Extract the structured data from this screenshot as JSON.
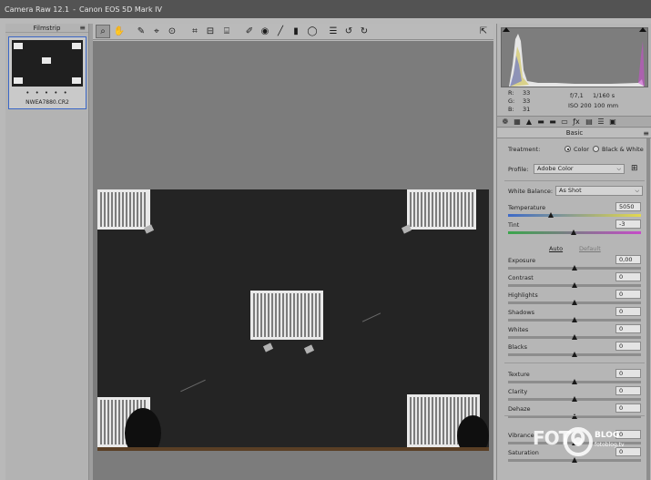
{
  "app": {
    "title": "Camera Raw 12.1",
    "separator": "-",
    "camera": "Canon EOS 5D Mark IV"
  },
  "filmstrip": {
    "header": "Filmstrip",
    "menu_icon": "panel-menu-icon",
    "thumbnail": {
      "dots": "• • • • •",
      "filename": "NWEA7880.CR2"
    }
  },
  "toolbar": {
    "icons": [
      "zoom-icon",
      "hand-icon",
      "white-balance-icon",
      "color-sampler-icon",
      "target-adjustment-icon",
      "crop-icon",
      "straighten-icon",
      "transform-icon",
      "spot-removal-icon",
      "red-eye-icon",
      "adjustment-brush-icon",
      "graduated-filter-icon",
      "radial-filter-icon",
      "preferences-icon",
      "rotate-left-icon",
      "rotate-right-icon"
    ],
    "fullscreen_icon": "toggle-fullscreen-icon"
  },
  "readout": {
    "r_label": "R:",
    "r_value": "33",
    "g_label": "G:",
    "g_value": "33",
    "b_label": "B:",
    "b_value": "31",
    "aperture": "f/7,1",
    "shutter": "1/160 s",
    "iso": "ISO 200",
    "focal": "100 mm"
  },
  "panel_tabs": [
    "basic-icon",
    "tone-curve-icon",
    "detail-icon",
    "hsl-icon",
    "split-toning-icon",
    "lens-icon",
    "effects-icon",
    "calibration-icon",
    "presets-icon",
    "snapshots-icon"
  ],
  "basic": {
    "header": "Basic",
    "treatment_label": "Treatment:",
    "treatment_color": "Color",
    "treatment_bw": "Black & White",
    "profile_label": "Profile:",
    "profile_value": "Adobe Color",
    "wb_label": "White Balance:",
    "wb_value": "As Shot",
    "auto": "Auto",
    "default": "Default",
    "sliders": [
      {
        "label": "Temperature",
        "value": "5050",
        "position": 0.32
      },
      {
        "label": "Tint",
        "value": "-3",
        "position": 0.49
      },
      {
        "label": "Exposure",
        "value": "0,00",
        "position": 0.5
      },
      {
        "label": "Contrast",
        "value": "0",
        "position": 0.5
      },
      {
        "label": "Highlights",
        "value": "0",
        "position": 0.5
      },
      {
        "label": "Shadows",
        "value": "0",
        "position": 0.5
      },
      {
        "label": "Whites",
        "value": "0",
        "position": 0.5
      },
      {
        "label": "Blacks",
        "value": "0",
        "position": 0.5
      },
      {
        "label": "Texture",
        "value": "0",
        "position": 0.5
      },
      {
        "label": "Clarity",
        "value": "0",
        "position": 0.5
      },
      {
        "label": "Dehaze",
        "value": "0",
        "position": 0.5
      },
      {
        "label": "Vibrance",
        "value": "0",
        "position": 0.5
      },
      {
        "label": "Saturation",
        "value": "0",
        "position": 0.5
      }
    ]
  },
  "watermark": {
    "logo": "FOTO",
    "brand": "BLOG",
    "site": "fotoblog.tv"
  }
}
